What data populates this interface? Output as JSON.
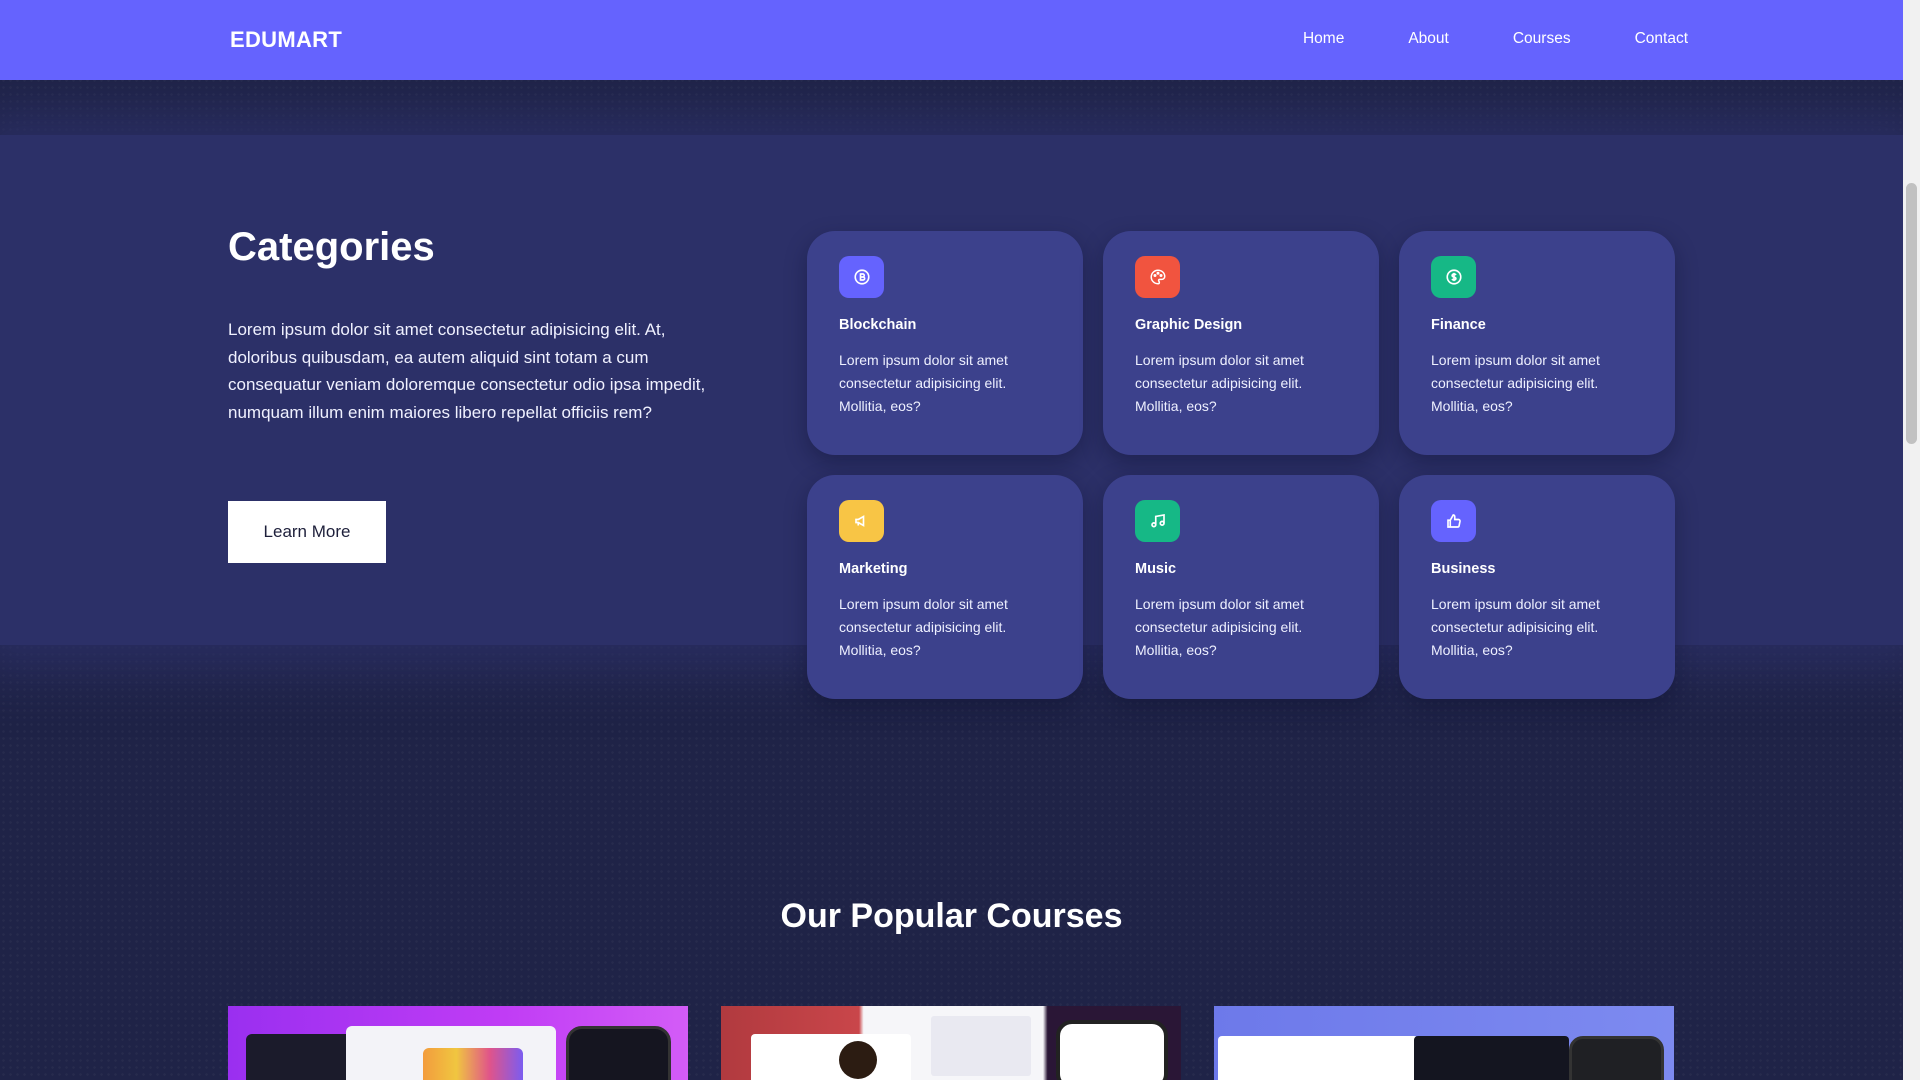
{
  "nav": {
    "brand": "EDUMART",
    "links": [
      "Home",
      "About",
      "Courses",
      "Contact"
    ]
  },
  "categories": {
    "title": "Categories",
    "description": "Lorem ipsum dolor sit amet consectetur adipisicing elit. At, doloribus quibusdam, ea autem aliquid sint totam a cum consequatur veniam doloremque consectetur odio ipsa impedit, numquam illum enim maiores libero repellat officiis rem?",
    "button_label": "Learn More",
    "items": [
      {
        "title": "Blockchain",
        "text": "Lorem ipsum dolor sit amet consectetur adipisicing elit. Mollitia, eos?",
        "icon": "bitcoin-icon",
        "color": "#6563fe"
      },
      {
        "title": "Graphic Design",
        "text": "Lorem ipsum dolor sit amet consectetur adipisicing elit. Mollitia, eos?",
        "icon": "palette-icon",
        "color": "#f1543f"
      },
      {
        "title": "Finance",
        "text": "Lorem ipsum dolor sit amet consectetur adipisicing elit. Mollitia, eos?",
        "icon": "dollar-coin-icon",
        "color": "#16b886"
      },
      {
        "title": "Marketing",
        "text": "Lorem ipsum dolor sit amet consectetur adipisicing elit. Mollitia, eos?",
        "icon": "megaphone-icon",
        "color": "#f8c545"
      },
      {
        "title": "Music",
        "text": "Lorem ipsum dolor sit amet consectetur adipisicing elit. Mollitia, eos?",
        "icon": "music-note-icon",
        "color": "#16b886"
      },
      {
        "title": "Business",
        "text": "Lorem ipsum dolor sit amet consectetur adipisicing elit. Mollitia, eos?",
        "icon": "thumbs-up-icon",
        "color": "#6563fe"
      }
    ]
  },
  "courses": {
    "title": "Our Popular Courses"
  }
}
